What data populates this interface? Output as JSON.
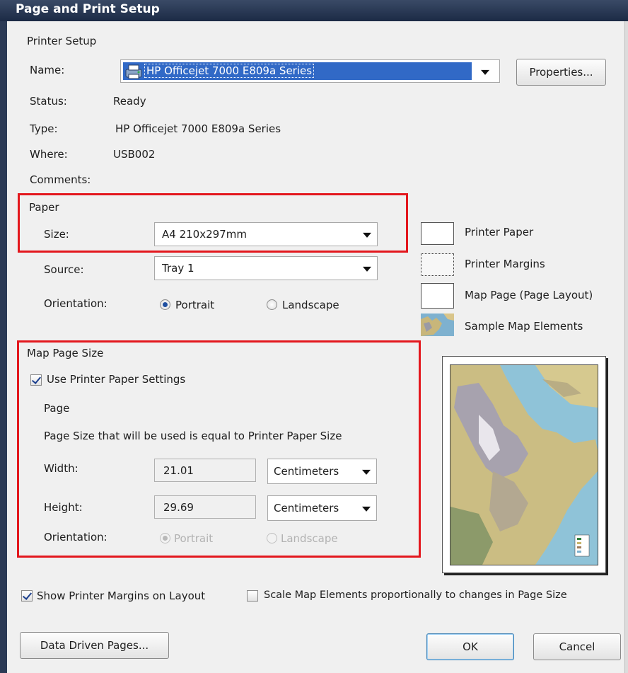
{
  "window": {
    "title": "Page and Print Setup"
  },
  "printer_setup": {
    "heading": "Printer Setup",
    "name_label": "Name:",
    "name_value": "HP Officejet 7000 E809a Series",
    "properties_button": "Properties...",
    "status_label": "Status:",
    "status_value": "Ready",
    "type_label": "Type:",
    "type_value": "HP Officejet 7000 E809a Series",
    "where_label": "Where:",
    "where_value": "USB002",
    "comments_label": "Comments:"
  },
  "paper": {
    "heading": "Paper",
    "size_label": "Size:",
    "size_value": "A4 210x297mm",
    "source_label": "Source:",
    "source_value": "Tray 1",
    "orientation_label": "Orientation:",
    "portrait_label": "Portrait",
    "landscape_label": "Landscape",
    "orientation_selected": "Portrait"
  },
  "legend": {
    "printer_paper": "Printer Paper",
    "printer_margins": "Printer Margins",
    "map_page": "Map Page (Page Layout)",
    "sample_map_elements": "Sample Map Elements"
  },
  "map_page_size": {
    "heading": "Map Page Size",
    "use_printer_settings_label": "Use Printer Paper Settings",
    "use_printer_settings_checked": true,
    "page_heading": "Page",
    "page_note": "Page Size that will be used is equal to Printer Paper Size",
    "width_label": "Width:",
    "width_value": "21.01",
    "width_unit": "Centimeters",
    "height_label": "Height:",
    "height_value": "29.69",
    "height_unit": "Centimeters",
    "orientation_label": "Orientation:",
    "portrait_label": "Portrait",
    "landscape_label": "Landscape",
    "orientation_selected": "Portrait"
  },
  "options": {
    "show_margins_label": "Show Printer Margins on Layout",
    "show_margins_checked": true,
    "scale_elements_label": "Scale Map Elements proportionally to changes in Page Size",
    "scale_elements_checked": false
  },
  "footer": {
    "data_driven_pages_button": "Data Driven Pages...",
    "ok_button": "OK",
    "cancel_button": "Cancel"
  },
  "colors": {
    "highlight_box": "#e3171d",
    "selection": "#3169c6"
  }
}
